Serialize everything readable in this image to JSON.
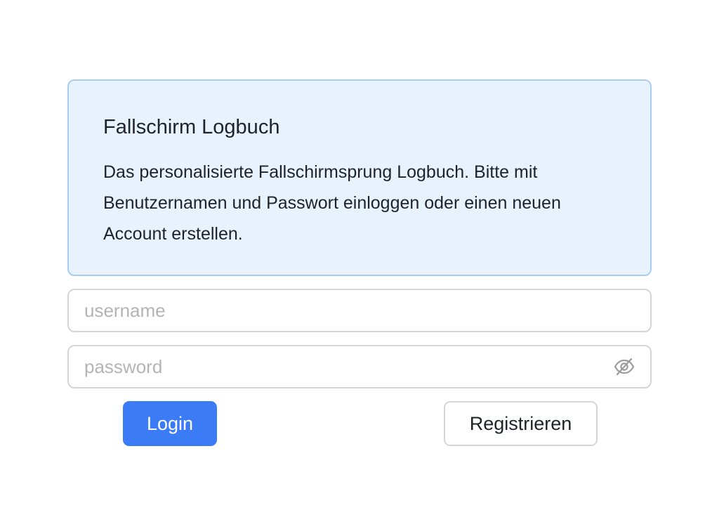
{
  "info": {
    "title": "Fallschirm Logbuch",
    "text": "Das personalisierte Fallschirmsprung Logbuch. Bitte mit Benutzernamen und Passwort einloggen oder einen neuen Account erstellen."
  },
  "form": {
    "username": {
      "value": "",
      "placeholder": "username"
    },
    "password": {
      "value": "",
      "placeholder": "password",
      "toggle_icon": "eye-slash-icon"
    }
  },
  "buttons": {
    "login_label": "Login",
    "register_label": "Registrieren"
  },
  "colors": {
    "accent": "#3b7bf6",
    "info_background": "#e8f2fd",
    "info_border": "#a9cdf2"
  }
}
